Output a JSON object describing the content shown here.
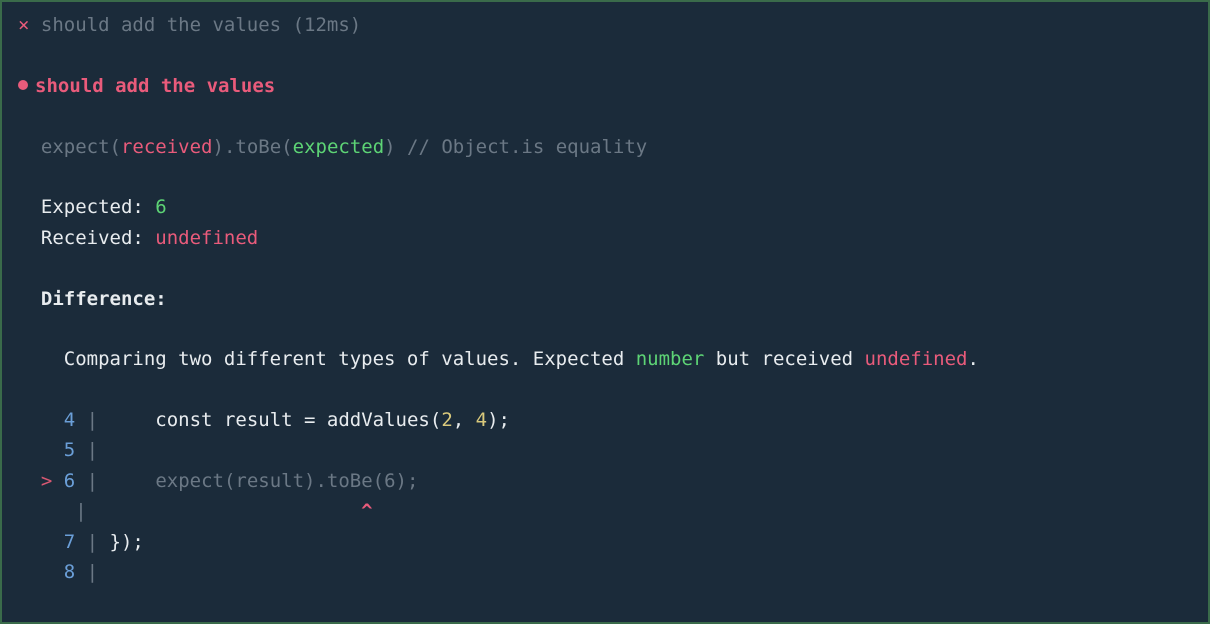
{
  "summary": {
    "fail_marker": "×",
    "test_name": "should add the values",
    "duration": "(12ms)"
  },
  "failing": {
    "test_name": "should add the values"
  },
  "assertion": {
    "expect_label": "expect",
    "open_paren": "(",
    "received_token": "received",
    "close_paren": ")",
    "dot": ".",
    "matcher": "toBe",
    "expected_token": "expected",
    "comment": " // Object.is equality"
  },
  "values": {
    "expected_label": "Expected: ",
    "expected_value": "6",
    "received_label": "Received: ",
    "received_value": "undefined"
  },
  "difference": {
    "heading": "Difference:",
    "prefix": "Comparing two different types of values. Expected ",
    "expected_type": "number",
    "mid": " but received ",
    "received_type": "undefined",
    "suffix": "."
  },
  "code": {
    "l4_num": "4",
    "l4_pipe": " |     ",
    "l4_const": "const",
    "l4_text1": " result ",
    "l4_eq": "=",
    "l4_text2": " addValues(",
    "l4_n1": "2",
    "l4_comma": ", ",
    "l4_n2": "4",
    "l4_end": ");",
    "l5_num": "5",
    "l5_pipe": " |",
    "l6_marker": "> ",
    "l6_num": "6",
    "l6_pipe": " |     ",
    "l6_text": "expect(result).toBe(",
    "l6_n": "6",
    "l6_end": ");",
    "caret_lead": "     |                        ",
    "caret": "^",
    "l7_num": "7",
    "l7_pipe": " | ",
    "l7_text": "});",
    "l8_num": "8",
    "l8_pipe": " |"
  }
}
